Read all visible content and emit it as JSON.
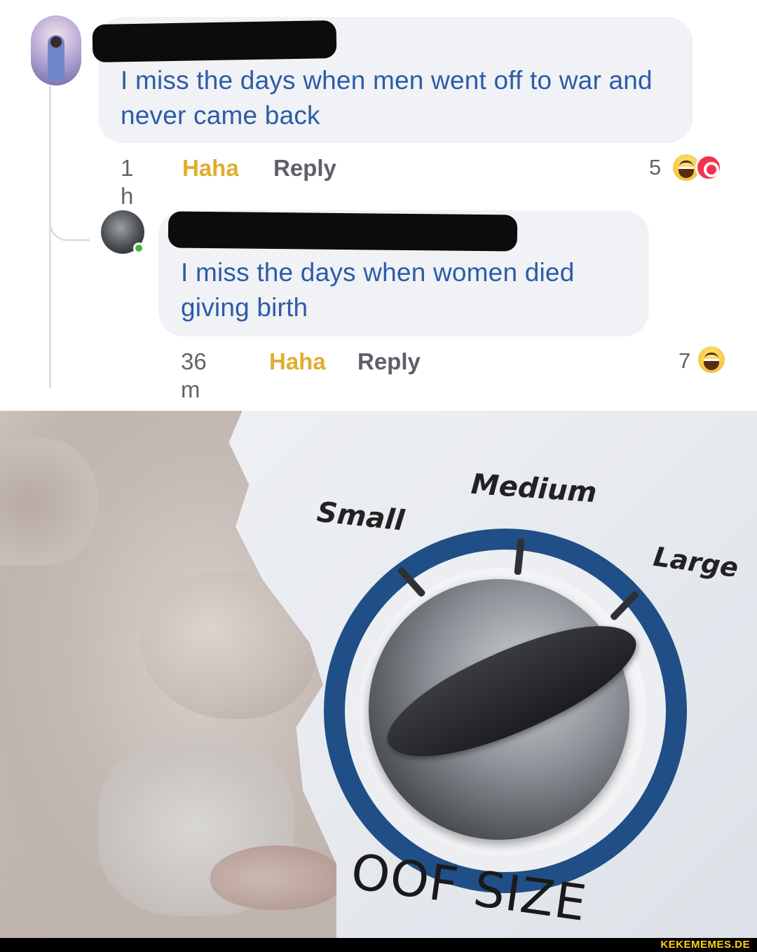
{
  "comments": [
    {
      "author": "",
      "text": "I miss the days when men went off to war and never came back",
      "time": "1 h",
      "haha_label": "Haha",
      "reply_label": "Reply",
      "reaction_count": "5",
      "reaction_icons": [
        "haha-emoji-icon",
        "love-reaction-icon"
      ]
    },
    {
      "author": "",
      "text": "I miss the days when women died giving birth",
      "time": "36 m",
      "haha_label": "Haha",
      "reply_label": "Reply",
      "reaction_count": "7",
      "reaction_icons": [
        "haha-emoji-icon"
      ]
    }
  ],
  "meme": {
    "dial_labels": {
      "small": "Small",
      "medium": "Medium",
      "large": "Large"
    },
    "caption": "OOF SIZE",
    "selected_setting": "Large"
  },
  "watermark": "KEKEMEMES.DE",
  "colors": {
    "comment_text": "#2e5ba8",
    "haha": "#e1ad2c",
    "bubble": "#f0f2f5",
    "dial_ring": "#1f4f86",
    "watermark": "#ffd21a"
  }
}
